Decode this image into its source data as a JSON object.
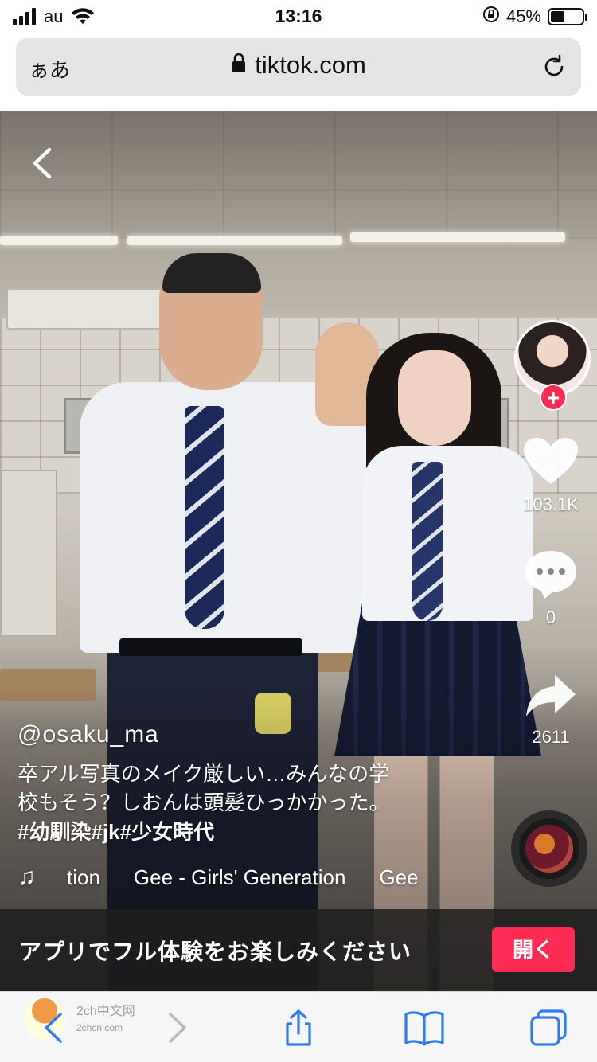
{
  "status": {
    "carrier": "au",
    "time": "13:16",
    "battery_percent": "45%",
    "battery_level": 0.45
  },
  "address_bar": {
    "aa_label": "ぁあ",
    "url": "tiktok.com"
  },
  "video": {
    "username": "@osaku_ma",
    "description_line1": "卒アル写真のメイク厳しい…みんなの学",
    "description_line2": "校もそう？しおんは頭髪ひっかかった。",
    "hashtags": [
      "#幼馴染",
      "#jk",
      "#少女時代"
    ],
    "music_scroll": [
      "tion",
      "Gee - Girls' Generation",
      "Gee"
    ]
  },
  "rail": {
    "like_count": "103.1K",
    "comment_count": "0",
    "share_count": "2611"
  },
  "banner": {
    "message": "アプリでフル体験をお楽しみください",
    "open_label": "開く"
  },
  "watermark": {
    "text": "2ch中文网",
    "sub": "2chcn.com"
  },
  "colors": {
    "accent": "#fe2c55",
    "toolbar_icon": "#2f7bf6"
  },
  "icons": [
    "signal-icon",
    "wifi-icon",
    "lock-icon",
    "reload-icon",
    "back-chevron-icon",
    "heart-icon",
    "comment-icon",
    "share-icon",
    "music-note-icon",
    "safari-back-icon",
    "safari-forward-icon",
    "share-sheet-icon",
    "bookmarks-icon",
    "tabs-icon"
  ]
}
